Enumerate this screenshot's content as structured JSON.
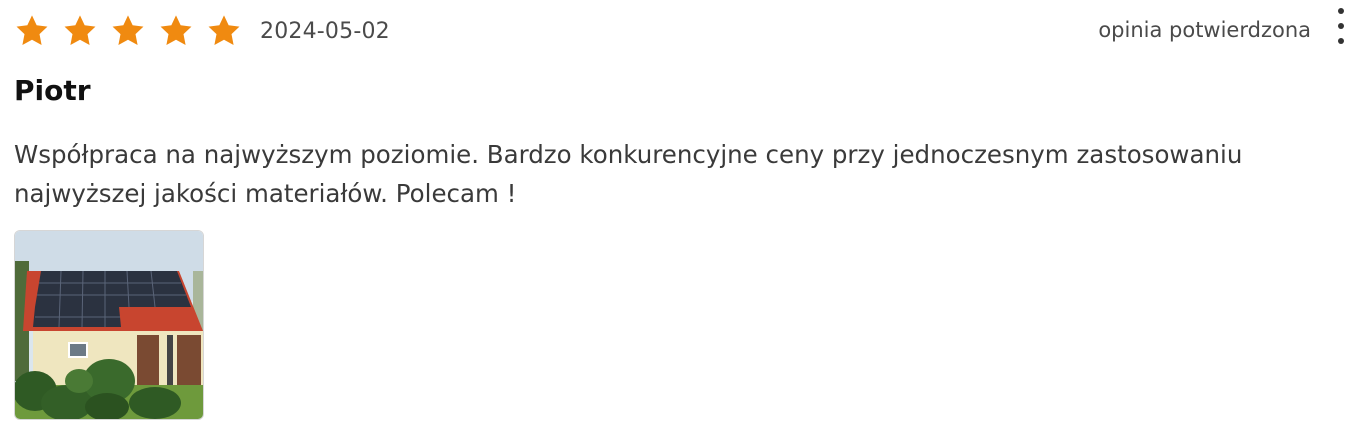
{
  "review": {
    "rating": 5,
    "rating_max": 5,
    "star_color": "#F08A10",
    "star_icon": "star-icon",
    "date": "2024-05-02",
    "verified_label": "opinia potwierdzona",
    "menu_icon": "more-vertical-icon",
    "author": "Piotr",
    "text": "Współpraca na najwyższym poziomie. Bardzo konkurencyjne ceny przy jednoczesnym zastosowaniu najwyższej jakości materiałów. Polecam !",
    "photo_icon": "review-photo-thumbnail"
  }
}
